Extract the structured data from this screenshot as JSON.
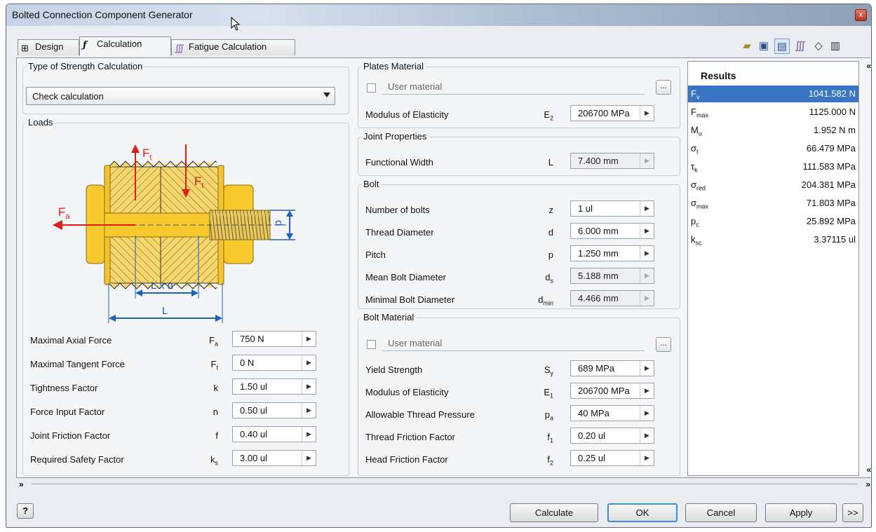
{
  "window": {
    "title": "Bolted Connection Component Generator",
    "close_label": "x"
  },
  "tabs": [
    {
      "label": "Design",
      "icon": "bolt-design-icon"
    },
    {
      "label": "Calculation",
      "icon": "function-icon"
    },
    {
      "label": "Fatigue Calculation",
      "icon": "fatigue-chart-icon"
    }
  ],
  "toolbar": [
    "open-icon",
    "save-icon",
    "results-view-icon",
    "fatigue-icon",
    "eraser-icon",
    "clipboard-icon"
  ],
  "strength": {
    "legend": "Type of Strength Calculation",
    "selected": "Check calculation"
  },
  "loads": {
    "legend": "Loads",
    "diagram": {
      "fa": "F",
      "fa_sub": "a",
      "ft": "F",
      "ft_sub": "t",
      "d": "d",
      "lxn": "L x n",
      "l": "L"
    },
    "rows": [
      {
        "label": "Maximal Axial Force",
        "sym": "F",
        "sub": "a",
        "value": "750 N"
      },
      {
        "label": "Maximal Tangent Force",
        "sym": "F",
        "sub": "t",
        "value": "0 N"
      },
      {
        "label": "Tightness Factor",
        "sym": "k",
        "sub": "",
        "value": "1.50 ul"
      },
      {
        "label": "Force Input Factor",
        "sym": "n",
        "sub": "",
        "value": "0.50 ul"
      },
      {
        "label": "Joint Friction Factor",
        "sym": "f",
        "sub": "",
        "value": "0.40 ul"
      },
      {
        "label": "Required Safety Factor",
        "sym": "k",
        "sub": "s",
        "value": "3.00 ul"
      }
    ]
  },
  "plates": {
    "legend": "Plates Material",
    "user_material": "User material",
    "dots": "...",
    "modulus": {
      "label": "Modulus of Elasticity",
      "sym": "E",
      "sub": "2",
      "value": "206700 MPa"
    }
  },
  "joint": {
    "legend": "Joint Properties",
    "width": {
      "label": "Functional Width",
      "sym": "L",
      "sub": "",
      "value": "7.400 mm"
    }
  },
  "bolt": {
    "legend": "Bolt",
    "rows": [
      {
        "label": "Number of bolts",
        "sym": "z",
        "sub": "",
        "value": "1 ul",
        "ro": false
      },
      {
        "label": "Thread Diameter",
        "sym": "d",
        "sub": "",
        "value": "6.000 mm",
        "ro": false
      },
      {
        "label": "Pitch",
        "sym": "p",
        "sub": "",
        "value": "1.250 mm",
        "ro": false
      },
      {
        "label": "Mean Bolt Diameter",
        "sym": "d",
        "sub": "s",
        "value": "5.188 mm",
        "ro": true
      },
      {
        "label": "Minimal Bolt Diameter",
        "sym": "d",
        "sub": "min",
        "value": "4.466 mm",
        "ro": true
      }
    ]
  },
  "bolt_material": {
    "legend": "Bolt Material",
    "user_material": "User material",
    "dots": "...",
    "rows": [
      {
        "label": "Yield Strength",
        "sym": "S",
        "sub": "y",
        "value": "689 MPa"
      },
      {
        "label": "Modulus of Elasticity",
        "sym": "E",
        "sub": "1",
        "value": "206700 MPa"
      },
      {
        "label": "Allowable Thread Pressure",
        "sym": "p",
        "sub": "a",
        "value": "40 MPa"
      },
      {
        "label": "Thread Friction Factor",
        "sym": "f",
        "sub": "1",
        "value": "0.20 ul"
      },
      {
        "label": "Head Friction Factor",
        "sym": "f",
        "sub": "2",
        "value": "0.25 ul"
      }
    ]
  },
  "results": {
    "title": "Results",
    "rows": [
      {
        "sym": "F",
        "sub": "v",
        "value": "1041.582 N"
      },
      {
        "sym": "F",
        "sub": "max",
        "value": "1125.000 N"
      },
      {
        "sym": "M",
        "sub": "u",
        "value": "1.952 N m"
      },
      {
        "sym": "σ",
        "sub": "t",
        "value": "66.479 MPa"
      },
      {
        "sym": "τ",
        "sub": "k",
        "value": "111.583 MPa"
      },
      {
        "sym": "σ",
        "sub": "red",
        "value": "204.381 MPa"
      },
      {
        "sym": "σ",
        "sub": "max",
        "value": "71.803 MPa"
      },
      {
        "sym": "p",
        "sub": "c",
        "value": "25.892 MPa"
      },
      {
        "sym": "k",
        "sub": "sc",
        "value": "3.37115 ul"
      }
    ],
    "collapse": "«"
  },
  "footer": {
    "help": "?",
    "calculate": "Calculate",
    "ok": "OK",
    "cancel": "Cancel",
    "apply": "Apply",
    "more": ">>",
    "expand_left": "»",
    "expand_right": "»"
  }
}
